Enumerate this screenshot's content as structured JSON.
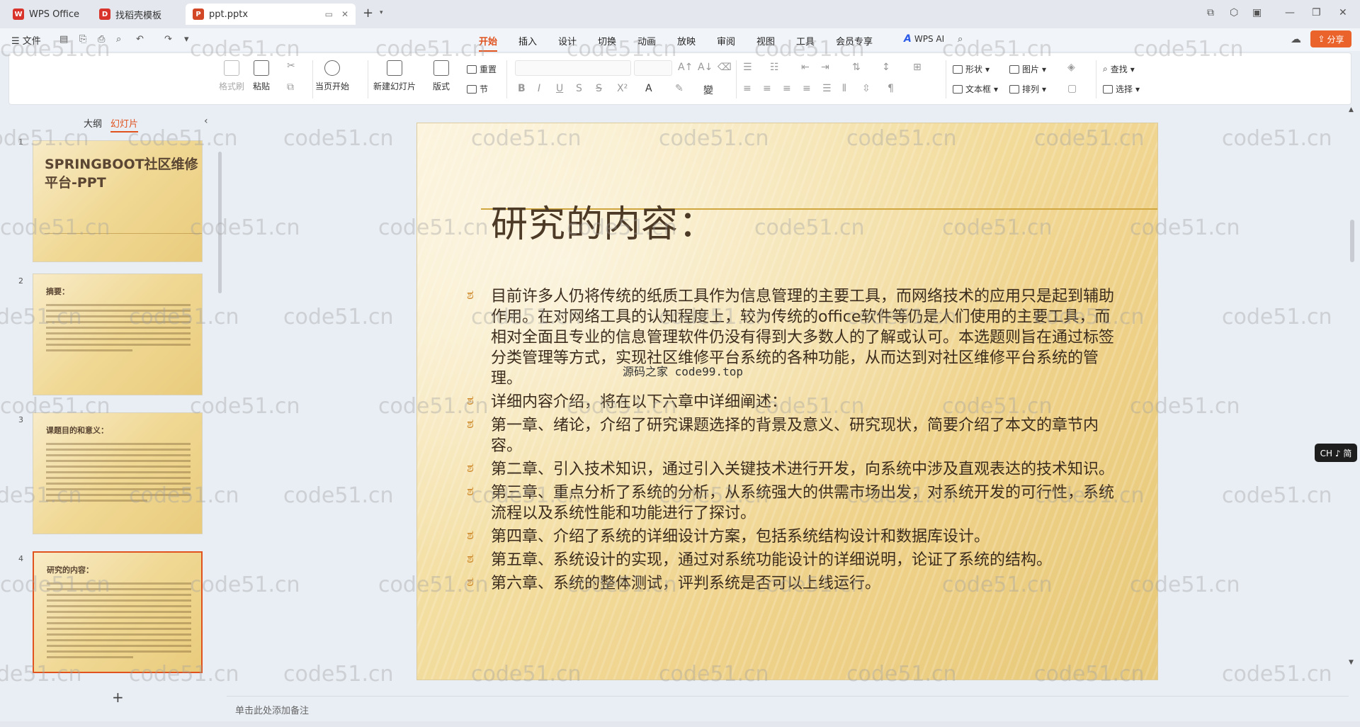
{
  "tabs": [
    {
      "label": "WPS Office",
      "active": false
    },
    {
      "label": "找稻壳模板",
      "active": false
    },
    {
      "label": "ppt.pptx",
      "active": true
    }
  ],
  "menu": {
    "file_label": "文件",
    "ribbon_tabs": [
      "开始",
      "插入",
      "设计",
      "切换",
      "动画",
      "放映",
      "审阅",
      "视图",
      "工具",
      "会员专享"
    ],
    "active_tab": "开始",
    "wps_ai": "WPS AI",
    "share": "分享"
  },
  "ribbon": {
    "format_painter": "格式刷",
    "paste": "粘贴",
    "from_current": "当页开始",
    "new_slide": "新建幻灯片",
    "layout": "版式",
    "reset": "重置",
    "section": "节",
    "shape": "形状",
    "picture": "图片",
    "find": "查找",
    "textbox": "文本框",
    "arrange": "排列",
    "select": "选择"
  },
  "left_pane": {
    "outline_tab": "大纲",
    "slides_tab": "幻灯片",
    "thumbnails": [
      {
        "num": "1",
        "title": "SPRINGBOOT社区维修平台-PPT"
      },
      {
        "num": "2",
        "title": "摘要："
      },
      {
        "num": "3",
        "title": "课题目的和意义："
      },
      {
        "num": "4",
        "title": "研究的内容："
      }
    ]
  },
  "slide": {
    "title": "研究的内容：",
    "bullets": [
      "目前许多人仍将传统的纸质工具作为信息管理的主要工具，而网络技术的应用只是起到辅助作用。在对网络工具的认知程度上，较为传统的office软件等仍是人们使用的主要工具，而相对全面且专业的信息管理软件仍没有得到大多数人的了解或认可。本选题则旨在通过标签分类管理等方式，实现社区维修平台系统的各种功能，从而达到对社区维修平台系统的管理。",
      "详细内容介绍，将在以下六章中详细阐述：",
      "第一章、绪论，介绍了研究课题选择的背景及意义、研究现状，简要介绍了本文的章节内容。",
      "第二章、引入技术知识，通过引入关键技术进行开发，向系统中涉及直观表达的技术知识。",
      "第三章、重点分析了系统的分析，从系统强大的供需市场出发，对系统开发的可行性，系统流程以及系统性能和功能进行了探讨。",
      "第四章、介绍了系统的详细设计方案，包括系统结构设计和数据库设计。",
      "第五章、系统设计的实现，通过对系统功能设计的详细说明，论证了系统的结构。",
      "第六章、系统的整体测试，评判系统是否可以上线运行。"
    ],
    "overlay_text": "源码之家 code99.top"
  },
  "ime_indicator": "CH ♪ 简",
  "notes_placeholder": "单击此处添加备注",
  "watermark_text": "code51.cn",
  "colors": {
    "accent": "#e0531f",
    "share": "#e9632a",
    "slide_title": "#4d3a26"
  }
}
